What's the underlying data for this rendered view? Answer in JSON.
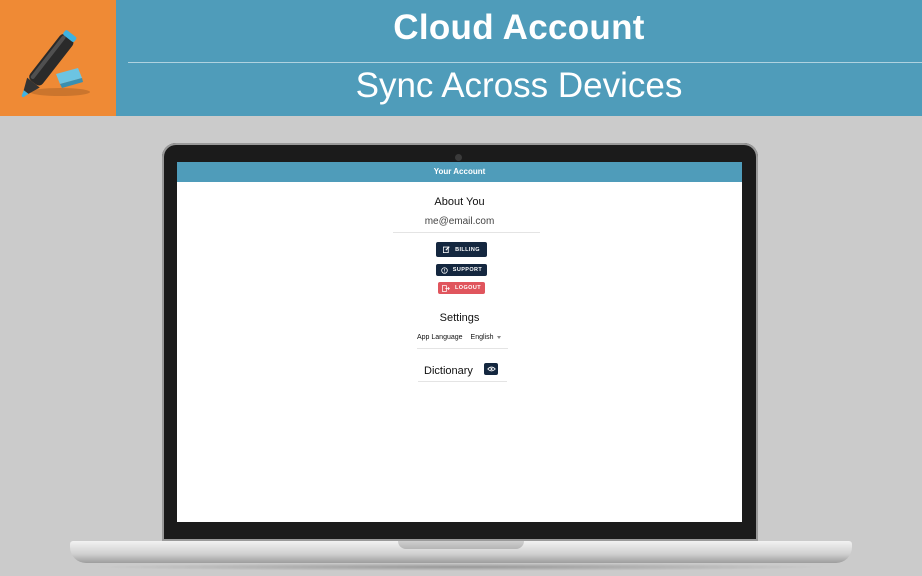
{
  "banner": {
    "title": "Cloud Account",
    "subtitle": "Sync Across Devices",
    "logo_icon": "highlighter-marker-icon",
    "bg_color": "#4f9cba",
    "logo_bg_color": "#ef8a35"
  },
  "app": {
    "header_title": "Your Account",
    "about": {
      "title": "About You",
      "email": "me@email.com"
    },
    "buttons": {
      "billing": "BILLING",
      "support": "SUPPORT",
      "logout": "LOGOUT"
    },
    "settings": {
      "title": "Settings",
      "language_label": "App Language",
      "language_value": "English"
    },
    "dictionary": {
      "title": "Dictionary",
      "toggle_icon": "eye-icon"
    }
  }
}
